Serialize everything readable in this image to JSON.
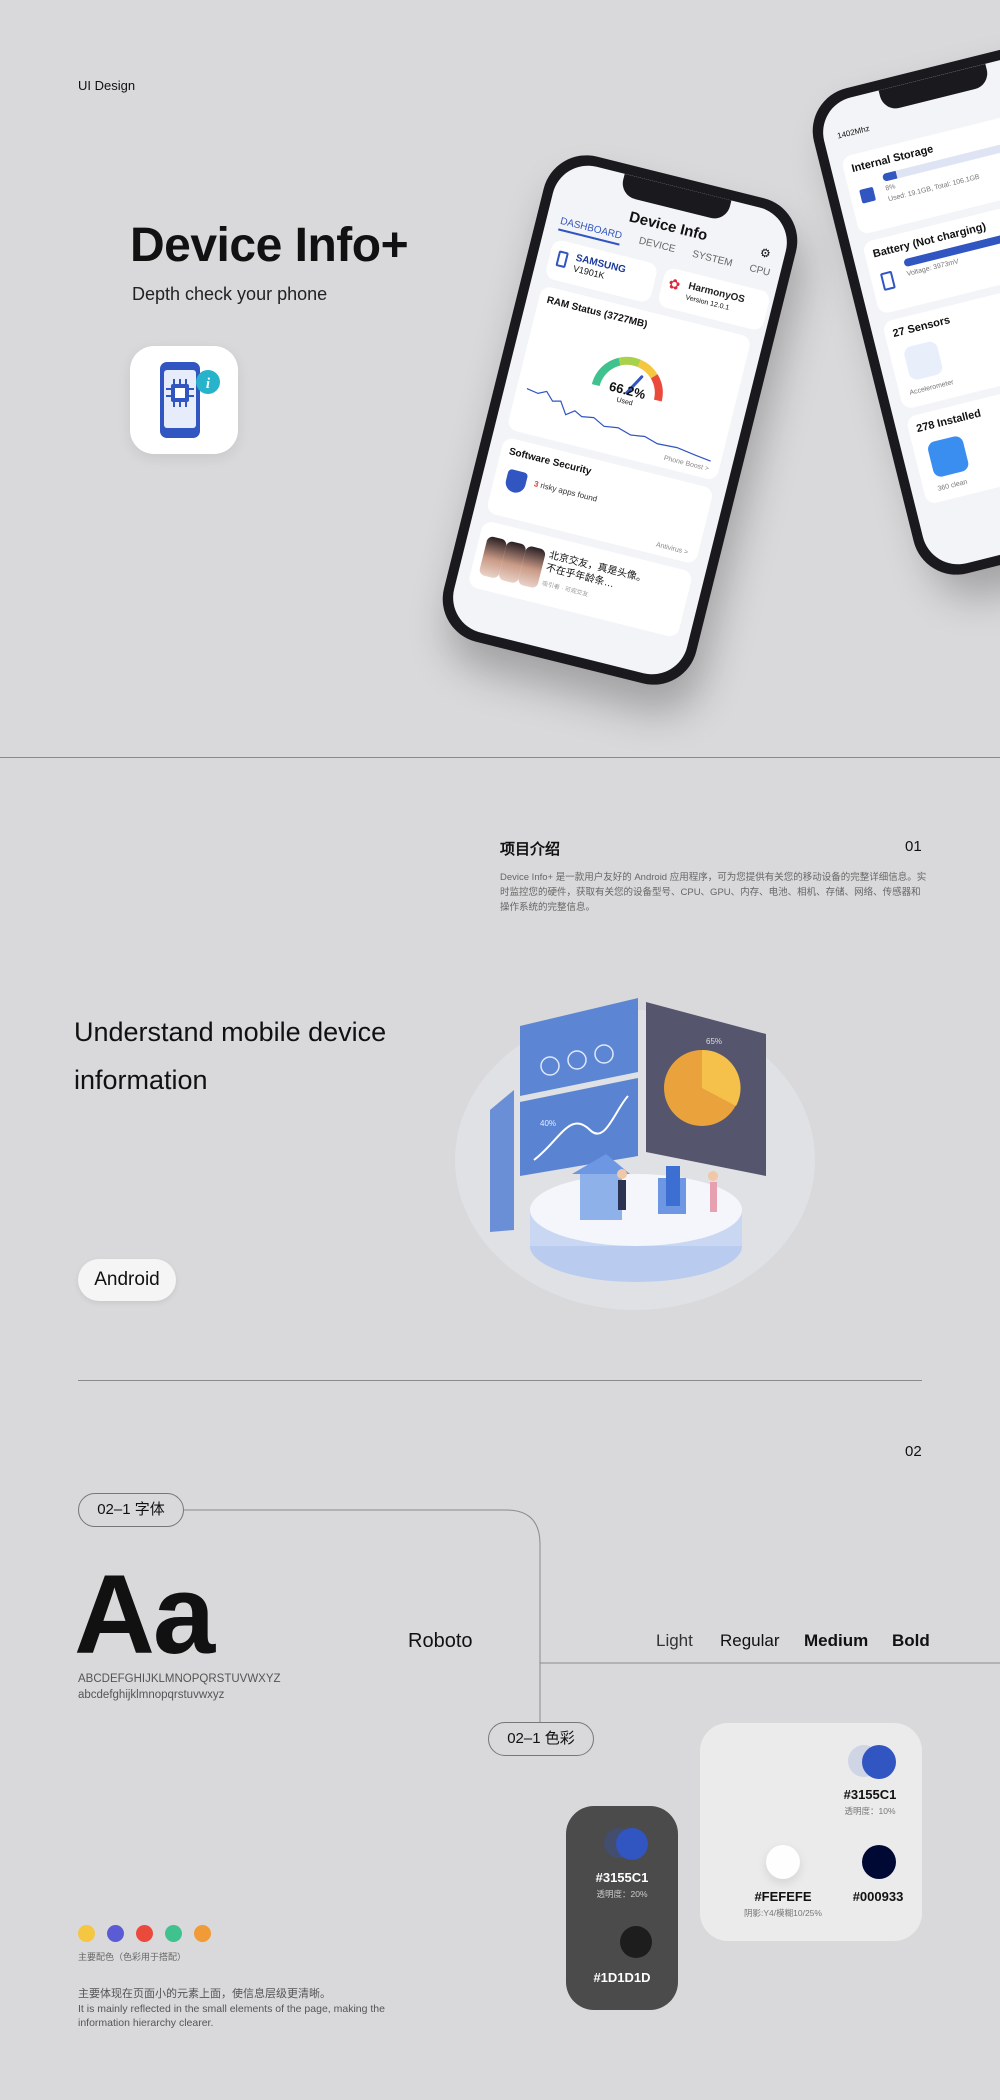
{
  "hero": {
    "label": "UI Design",
    "title": "Device Info+",
    "subtitle": "Depth check your phone"
  },
  "phone_main": {
    "title": "Device Info",
    "tabs": [
      "DASHBOARD",
      "DEVICE",
      "SYSTEM",
      "CPU"
    ],
    "brand_1": {
      "name": "SAMSUNG",
      "model": "V1901K"
    },
    "brand_2": {
      "name": "HarmonyOS",
      "version": "Version 12.0.1"
    },
    "ram": {
      "title": "RAM Status (3727MB)",
      "value": "66.2%",
      "used_label": "Used",
      "used_fraction": 0.662,
      "link": "Phone Boost >"
    },
    "security": {
      "title": "Software Security",
      "count": "3",
      "text": "risky apps found",
      "link": "Antivirus >"
    },
    "news": {
      "text": "北京交友，真是头像。不在乎年龄条…",
      "meta": "吸引者 · 可观交友"
    }
  },
  "phone_right": {
    "cpu": "1402Mhz",
    "storage": {
      "title": "Internal Storage",
      "badge": "8%",
      "detail": "Used: 19.1GB, Total: 106.1GB",
      "fraction": 0.08
    },
    "battery": {
      "title": "Battery (Not charging)",
      "detail": "Voltage: 3973mV"
    },
    "sensors": {
      "title": "27 Sensors",
      "item": "Accelerometer"
    },
    "apps": {
      "title": "278 Installed",
      "item": "360 clean"
    }
  },
  "intro": {
    "title": "项目介绍",
    "num": "01",
    "desc": "Device Info+ 是一款用户友好的 Android 应用程序，可为您提供有关您的移动设备的完整详细信息。实时监控您的硬件，获取有关您的设备型号、CPU、GPU、内存、电池、相机、存储、网络、传感器和操作系统的完整信息。",
    "headline": "Understand mobile device information",
    "platform": "Android",
    "illus_line": "40%",
    "illus_pie": "65%"
  },
  "typography": {
    "num": "02",
    "pill": "02–1 字体",
    "sample": "Aa",
    "font": "Roboto",
    "weights": [
      "Light",
      "Regular",
      "Medium",
      "Bold"
    ],
    "upper": "ABCDEFGHIJKLMNOPQRSTUVWXYZ",
    "lower": "abcdefghijklmnopqrstuvwxyz"
  },
  "colors": {
    "pill": "02–1 色彩",
    "dots": [
      "#F5C642",
      "#5B5BD6",
      "#E94A3C",
      "#3FC28E",
      "#F09A38"
    ],
    "dots_label": "主要配色（色彩用于搭配）",
    "footnote_cn": "主要体现在页面小的元素上面，使信息层级更清晰。",
    "footnote_en": "It is mainly reflected in the small elements of the page, making the information hierarchy clearer.",
    "dark": {
      "primary": "#3155C1",
      "primary_note": "透明度：20%",
      "secondary": "#1D1D1D"
    },
    "light": {
      "primary": "#3155C1",
      "primary_note": "透明度：10%",
      "white": "#FEFEFE",
      "white_note": "阴影:Y4/模糊10/25%",
      "black": "#000933"
    }
  }
}
